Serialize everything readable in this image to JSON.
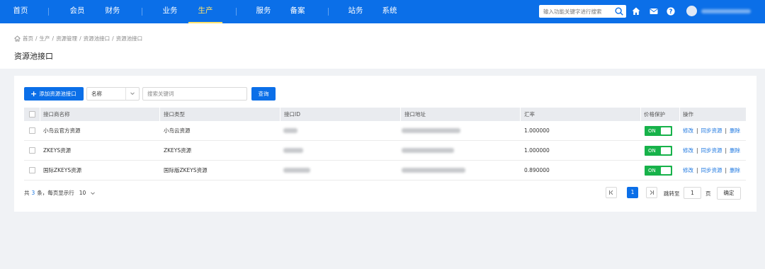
{
  "nav": {
    "items": [
      {
        "label": "首页"
      },
      {
        "label": "会员"
      },
      {
        "label": "财务"
      },
      {
        "label": "业务"
      },
      {
        "label": "生产"
      },
      {
        "label": "服务"
      },
      {
        "label": "备案"
      },
      {
        "label": "站务"
      },
      {
        "label": "系统"
      }
    ],
    "active": "生产",
    "search_placeholder": "输入功能关键字进行搜索",
    "icons": [
      "search-icon",
      "home-icon",
      "mail-icon",
      "help-icon",
      "avatar"
    ]
  },
  "breadcrumb": [
    "首页",
    "/",
    "生产",
    "/",
    "资源管理",
    "/",
    "资源池接口",
    "/",
    "资源池接口"
  ],
  "page_title": "资源池接口",
  "toolbar": {
    "add_label": "添加资源池接口",
    "select_value": "名称",
    "keyword_placeholder": "搜索关键词",
    "query_label": "查询"
  },
  "table": {
    "headers": {
      "name": "接口商名称",
      "type": "接口类型",
      "id": "接口ID",
      "address": "接口地址",
      "rate": "汇率",
      "protect": "价格保护",
      "ops": "操作"
    },
    "rows": [
      {
        "name": "小鸟云官方资源",
        "type": "小鸟云资源",
        "rate": "1.000000",
        "protect": "ON"
      },
      {
        "name": "ZKEYS资源",
        "type": "ZKEYS资源",
        "rate": "1.000000",
        "protect": "ON"
      },
      {
        "name": "国际ZKEYS资源",
        "type": "国际版ZKEYS资源",
        "rate": "0.890000",
        "protect": "ON"
      }
    ],
    "ops": {
      "edit": "修改",
      "sync": "同步资源",
      "delete": "删除",
      "sep": "|"
    }
  },
  "footer": {
    "total_prefix": "共",
    "total_count": "3",
    "total_suffix": "条，每页显示行",
    "page_size": "10",
    "current_page": "1",
    "goto_label": "跳转至",
    "goto_value": "1",
    "page_unit": "页",
    "confirm_label": "确定"
  },
  "colors": {
    "primary": "#0b6fe8",
    "active_nav": "#ffe36b",
    "toggle_on": "#17b24a",
    "link": "#1f78e0"
  }
}
